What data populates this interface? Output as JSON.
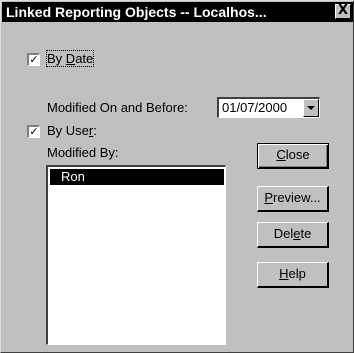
{
  "window": {
    "title": "Linked Reporting Objects -- Localhos...",
    "close_glyph": "X"
  },
  "by_date": {
    "checked": true,
    "check_glyph": "✓",
    "label_pre": "By ",
    "label_accel": "D",
    "label_post": "ate",
    "modified_label": "Modified On and Before:",
    "date_value": "01/07/2000"
  },
  "by_user": {
    "checked": true,
    "check_glyph": "✓",
    "label_pre": "By Use",
    "label_accel": "r",
    "label_post": ":",
    "modified_by_label": "Modified By:",
    "users": [
      "Ron"
    ]
  },
  "buttons": {
    "close": {
      "pre": "",
      "accel": "C",
      "post": "lose"
    },
    "preview": {
      "pre": "",
      "accel": "P",
      "post": "review..."
    },
    "delete": {
      "pre": "Del",
      "accel": "e",
      "post": "te"
    },
    "help": {
      "pre": "",
      "accel": "H",
      "post": "elp"
    }
  }
}
